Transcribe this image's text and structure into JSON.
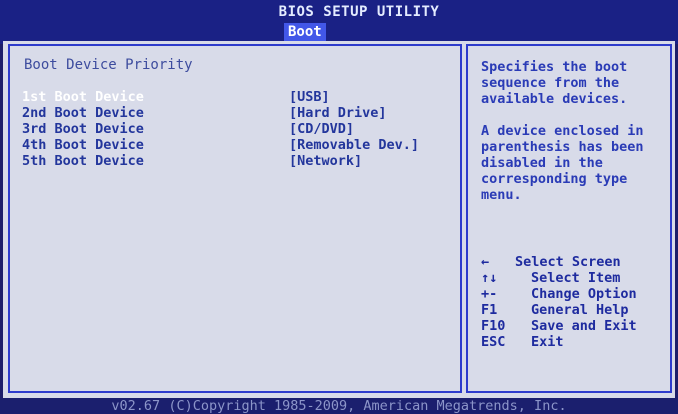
{
  "header": {
    "title": "BIOS SETUP UTILITY",
    "active_tab": "Boot"
  },
  "main": {
    "section_title": "Boot Device Priority",
    "boot_devices": [
      {
        "label": "1st Boot Device",
        "value": "[USB]",
        "selected": true
      },
      {
        "label": "2nd Boot Device",
        "value": "[Hard Drive]",
        "selected": false
      },
      {
        "label": "3rd Boot Device",
        "value": "[CD/DVD]",
        "selected": false
      },
      {
        "label": "4th Boot Device",
        "value": "[Removable Dev.]",
        "selected": false
      },
      {
        "label": "5th Boot Device",
        "value": "[Network]",
        "selected": false
      }
    ]
  },
  "help": {
    "description": "Specifies the boot\nsequence from the\navailable devices.",
    "note": "A device enclosed in\nparenthesis has been\ndisabled in the\ncorresponding type\nmenu.",
    "keys": [
      {
        "key": "←",
        "action": "Select Screen"
      },
      {
        "key": "↑↓",
        "action": "Select Item"
      },
      {
        "key": "+-",
        "action": "Change Option"
      },
      {
        "key": "F1",
        "action": "General Help"
      },
      {
        "key": "F10",
        "action": "Save and Exit"
      },
      {
        "key": "ESC",
        "action": "Exit"
      }
    ]
  },
  "footer": {
    "copyright": "v02.67 (C)Copyright 1985-2009, American Megatrends, Inc."
  },
  "colors": {
    "background": "#1d1e6a",
    "panel": "#d8dbe9",
    "border": "#2d3bcc",
    "text": "#23369c",
    "selected_text": "#ffffff",
    "tab_highlight": "#4257e8"
  }
}
